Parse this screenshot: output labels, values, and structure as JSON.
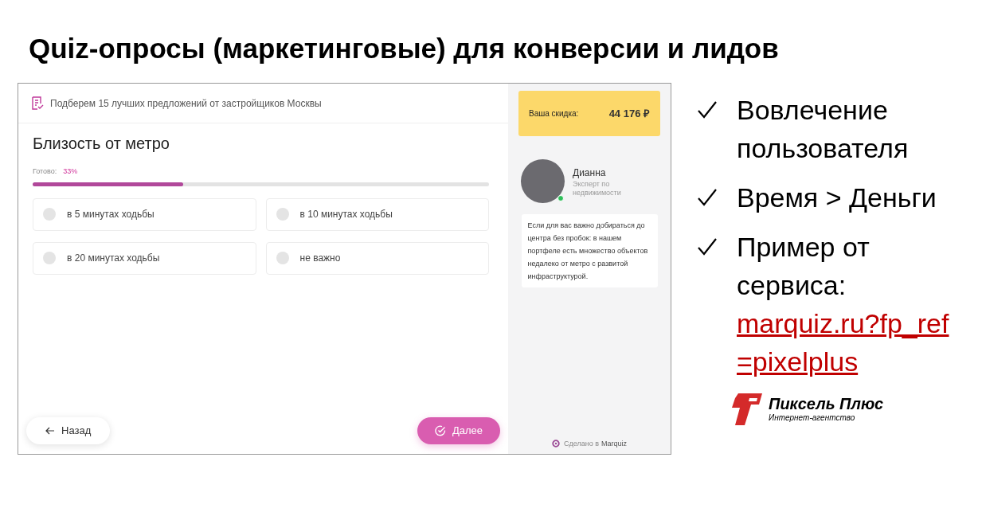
{
  "slide_title": "Quiz-опросы (маркетинговые) для конверсии и лидов",
  "quiz": {
    "header_text": "Подберем 15 лучших предложений от застройщиков Москвы",
    "question": "Близость от метро",
    "progress": {
      "label": "Готово:",
      "value": "33%",
      "level": 0.33
    },
    "options": [
      {
        "label": "в 5 минутах ходьбы",
        "selected": false
      },
      {
        "label": "в 10 минутах ходьбы",
        "selected": false
      },
      {
        "label": "в 20 минутах ходьбы",
        "selected": false
      },
      {
        "label": "не важно",
        "selected": false
      }
    ],
    "back_button": "Назад",
    "next_button": "Далее",
    "discount": {
      "label": "Ваша скидка:",
      "value": "44 176 ₽"
    },
    "expert": {
      "name": "Дианна",
      "role": "Эксперт по недвижимости",
      "online": true
    },
    "message": "Если для вас важно добираться до центра без пробок: в нашем портфеле есть множество объектов недалеко от метро с развитой инфраструктурой.",
    "footer": {
      "prefix": "Сделано в",
      "brand": "Marquiz"
    }
  },
  "bullets": [
    {
      "text": "Вовлечение пользователя"
    },
    {
      "text": "Время > Деньги"
    },
    {
      "text": "Пример от сервиса:",
      "link": "marquiz.ru?fp_ref=pixelplus"
    }
  ],
  "logo": {
    "name": "Пиксель Плюс",
    "tagline": "Интернет-агентство"
  }
}
